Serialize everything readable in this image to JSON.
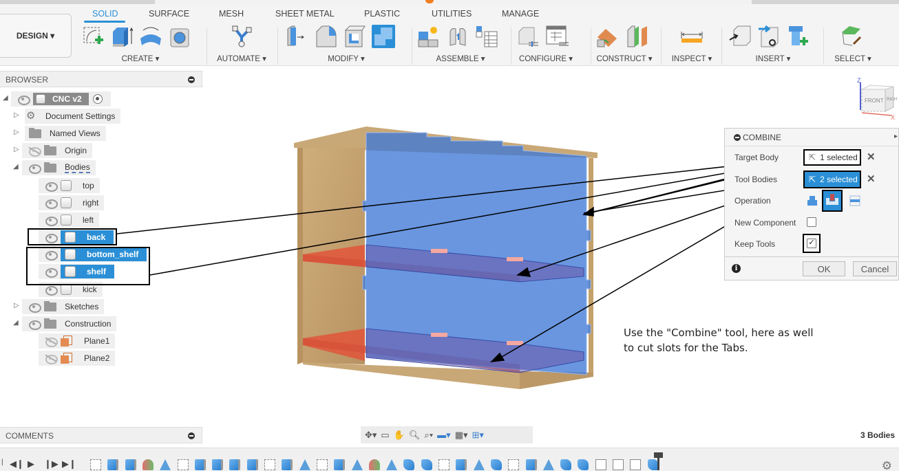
{
  "ribbon": {
    "workspace": "DESIGN",
    "tabs": [
      "SOLID",
      "SURFACE",
      "MESH",
      "SHEET METAL",
      "PLASTIC",
      "UTILITIES",
      "MANAGE"
    ],
    "active_tab": "SOLID",
    "groups": [
      "CREATE",
      "AUTOMATE",
      "MODIFY",
      "ASSEMBLE",
      "CONFIGURE",
      "CONSTRUCT",
      "INSPECT",
      "INSERT",
      "SELECT"
    ]
  },
  "browser": {
    "title": "BROWSER",
    "root": "CNC v2",
    "items": [
      {
        "label": "Document Settings",
        "icon": "gear-icon"
      },
      {
        "label": "Named Views",
        "icon": "folder-icon"
      },
      {
        "label": "Origin",
        "icon": "folder-icon",
        "visible": false
      },
      {
        "label": "Bodies",
        "icon": "folder-icon"
      }
    ],
    "bodies": [
      {
        "label": "top",
        "selected": false
      },
      {
        "label": "right",
        "selected": false
      },
      {
        "label": "left",
        "selected": false
      },
      {
        "label": "back",
        "selected": true
      },
      {
        "label": "bottom_shelf",
        "selected": true
      },
      {
        "label": "shelf",
        "selected": true
      },
      {
        "label": "kick",
        "selected": false
      }
    ],
    "after": [
      {
        "label": "Sketches",
        "icon": "folder-icon"
      },
      {
        "label": "Construction",
        "icon": "folder-icon"
      }
    ],
    "construction": [
      {
        "label": "Plane1"
      },
      {
        "label": "Plane2"
      }
    ]
  },
  "viewcube": {
    "front": "FRONT",
    "right": "RIGHT",
    "z": "Z",
    "x": "X"
  },
  "combine": {
    "title": "COMBINE",
    "target_body_label": "Target Body",
    "target_body_value": "1 selected",
    "tool_bodies_label": "Tool Bodies",
    "tool_bodies_value": "2 selected",
    "operation_label": "Operation",
    "operations": [
      "Join",
      "Cut",
      "Intersect"
    ],
    "selected_operation": "Cut",
    "new_component_label": "New Component",
    "new_component": false,
    "keep_tools_label": "Keep Tools",
    "keep_tools": true,
    "ok": "OK",
    "cancel": "Cancel"
  },
  "note": {
    "line1": "Use the \"Combine\" tool, here as well",
    "line2": "to cut slots for the Tabs."
  },
  "comments": {
    "title": "COMMENTS"
  },
  "status": {
    "bodies_count": "3 Bodies"
  },
  "colors": {
    "accent": "#2a8fd6",
    "target_body": "#4a7fd8",
    "tool_body": "#e0553a",
    "wood": "#c8a56f"
  }
}
